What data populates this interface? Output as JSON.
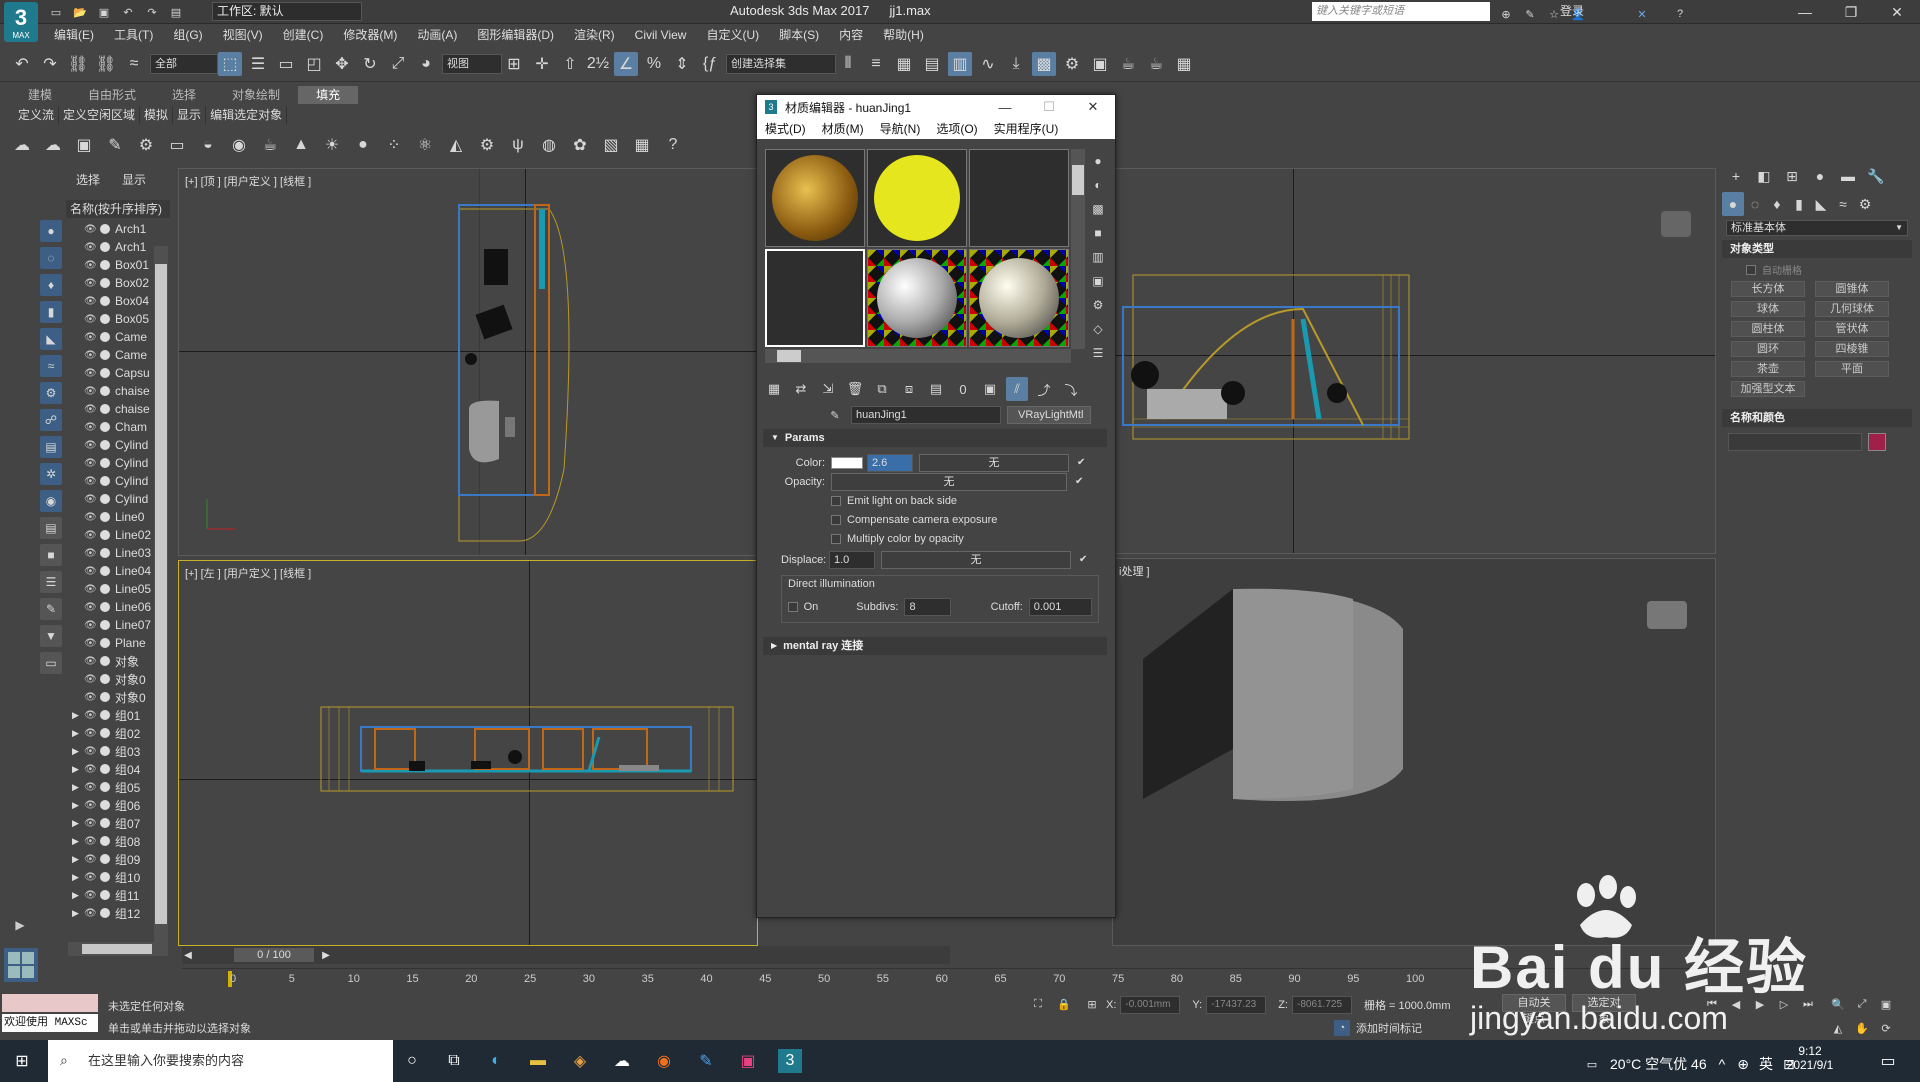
{
  "titlebar": {
    "workspace": "工作区: 默认",
    "app_title": "Autodesk 3ds Max 2017",
    "file_name": "jj1.max",
    "search_placeholder": "键入关键字或短语",
    "login": "登录",
    "logo_text": "3",
    "logo_sub": "MAX"
  },
  "menu": [
    "编辑(E)",
    "工具(T)",
    "组(G)",
    "视图(V)",
    "创建(C)",
    "修改器(M)",
    "动画(A)",
    "图形编辑器(D)",
    "渲染(R)",
    "Civil View",
    "自定义(U)",
    "脚本(S)",
    "内容",
    "帮助(H)"
  ],
  "maintoolbar": {
    "filter": "全部",
    "refcoord": "视图",
    "selection_set": "创建选择集"
  },
  "ribbon": {
    "tabs": [
      "建模",
      "自由形式",
      "选择",
      "对象绘制",
      "填充"
    ],
    "active": "填充",
    "subtabs": [
      "定义流",
      "定义空闲区域",
      "模拟",
      "显示",
      "编辑选定对象"
    ]
  },
  "scene_explorer": {
    "tabs": [
      "选择",
      "显示"
    ],
    "header": "名称(按升序排序)",
    "items": [
      {
        "name": "Arch1",
        "group": false
      },
      {
        "name": "Arch1",
        "group": false
      },
      {
        "name": "Box01",
        "group": false
      },
      {
        "name": "Box02",
        "group": false
      },
      {
        "name": "Box04",
        "group": false
      },
      {
        "name": "Box05",
        "group": false
      },
      {
        "name": "Came",
        "group": false
      },
      {
        "name": "Came",
        "group": false
      },
      {
        "name": "Capsu",
        "group": false
      },
      {
        "name": "chaise",
        "group": false
      },
      {
        "name": "chaise",
        "group": false
      },
      {
        "name": "Cham",
        "group": false
      },
      {
        "name": "Cylind",
        "group": false
      },
      {
        "name": "Cylind",
        "group": false
      },
      {
        "name": "Cylind",
        "group": false
      },
      {
        "name": "Cylind",
        "group": false
      },
      {
        "name": "Line0",
        "group": false
      },
      {
        "name": "Line02",
        "group": false
      },
      {
        "name": "Line03",
        "group": false
      },
      {
        "name": "Line04",
        "group": false
      },
      {
        "name": "Line05",
        "group": false
      },
      {
        "name": "Line06",
        "group": false
      },
      {
        "name": "Line07",
        "group": false
      },
      {
        "name": "Plane",
        "group": false
      },
      {
        "name": "对象",
        "group": false
      },
      {
        "name": "对象0",
        "group": false
      },
      {
        "name": "对象0",
        "group": false
      },
      {
        "name": "组01",
        "group": true
      },
      {
        "name": "组02",
        "group": true
      },
      {
        "name": "组03",
        "group": true
      },
      {
        "name": "组04",
        "group": true
      },
      {
        "name": "组05",
        "group": true
      },
      {
        "name": "组06",
        "group": true
      },
      {
        "name": "组07",
        "group": true
      },
      {
        "name": "组08",
        "group": true
      },
      {
        "name": "组09",
        "group": true
      },
      {
        "name": "组10",
        "group": true
      },
      {
        "name": "组11",
        "group": true
      },
      {
        "name": "组12",
        "group": true
      }
    ]
  },
  "viewports": {
    "top": "[+] [顶 ] [用户定义 ] [线框 ]",
    "left": "[+] [左 ] [用户定义 ] [线框 ]",
    "persp_partial": "i处理 ]"
  },
  "material_editor": {
    "title": "材质编辑器 - huanJing1",
    "menu": [
      "模式(D)",
      "材质(M)",
      "导航(N)",
      "选项(O)",
      "实用程序(U)"
    ],
    "material_name": "huanJing1",
    "material_type": "VRayLightMtl",
    "params": {
      "header": "Params",
      "color_label": "Color:",
      "color_value": "2.6",
      "none": "无",
      "opacity_label": "Opacity:",
      "emit_back": "Emit light on back side",
      "compensate": "Compensate camera exposure",
      "multiply": "Multiply color by opacity",
      "displace_label": "Displace:",
      "displace_value": "1.0",
      "direct_header": "Direct illumination",
      "on_label": "On",
      "subdivs_label": "Subdivs:",
      "subdivs_value": "8",
      "cutoff_label": "Cutoff:",
      "cutoff_value": "0.001"
    },
    "mental_ray": "mental ray 连接"
  },
  "command_panel": {
    "dropdown": "标准基本体",
    "object_type_header": "对象类型",
    "autogrid": "自动栅格",
    "buttons": [
      "长方体",
      "圆锥体",
      "球体",
      "几何球体",
      "圆柱体",
      "管状体",
      "圆环",
      "四棱锥",
      "茶壶",
      "平面",
      "加强型文本"
    ],
    "name_color_header": "名称和颜色",
    "object_color": "#a0204a"
  },
  "timeline": {
    "frame": "0 / 100",
    "ticks": [
      "0",
      "5",
      "10",
      "15",
      "20",
      "25",
      "30",
      "35",
      "40",
      "45",
      "50",
      "55",
      "60",
      "65",
      "70",
      "75",
      "80",
      "85",
      "90",
      "95",
      "100"
    ]
  },
  "status": {
    "welcome": "欢迎使用 MAXSc",
    "line1": "未选定任何对象",
    "line2": "单击或单击并拖动以选择对象",
    "x_label": "X:",
    "x_value": "-0.001mm",
    "y_label": "Y:",
    "y_value": "-17437.23",
    "z_label": "Z:",
    "z_value": "-8061.725",
    "grid": "栅格 = 1000.0mm",
    "add_time_tag": "添加时间标记",
    "autokey": "自动关键点",
    "selected": "选定对象"
  },
  "taskbar": {
    "search": "在这里输入你要搜索的内容",
    "weather": "20°C 空气优 46",
    "ime": "英",
    "time": "9:12",
    "date": "2021/9/1"
  },
  "watermark": {
    "main": "Bai du 经验",
    "sub": "jingyan.baidu.com"
  }
}
